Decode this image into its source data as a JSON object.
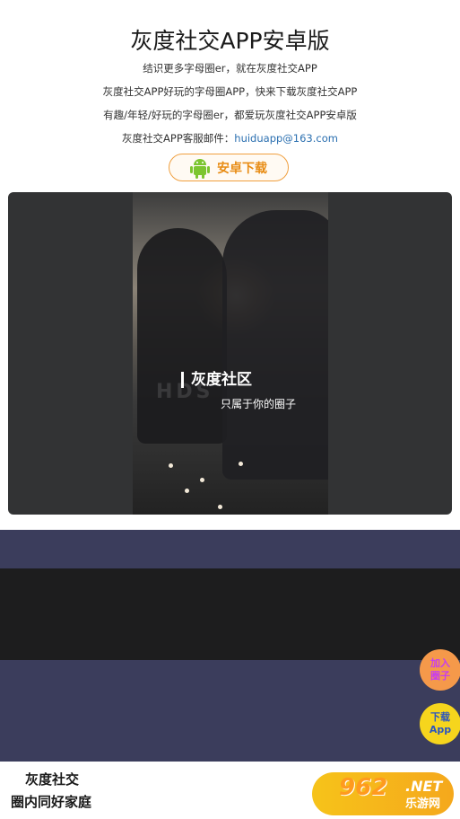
{
  "header": {
    "title": "灰度社交APP安卓版",
    "line1": "结识更多字母圈er，就在灰度社交APP",
    "line2": "灰度社交APP好玩的字母圈APP，快来下载灰度社交APP",
    "line3": "有趣/年轻/好玩的字母圈er，都爱玩灰度社交APP安卓版",
    "email_label": "灰度社交APP客服邮件：",
    "email": "huiduapp@163.com",
    "download_button": "安卓下载"
  },
  "video": {
    "title": "灰度社区",
    "subtitle": "只属于你的圈子",
    "watermark": "HDS"
  },
  "floating": {
    "join_line1": "加入",
    "join_line2": "圈子",
    "download_line1": "下载",
    "download_line2": "App"
  },
  "footer": {
    "line1": "灰度社交",
    "line2": "圈内同好家庭"
  },
  "watermark": {
    "number": "962",
    "net": ".NET",
    "site": "乐游网"
  },
  "colors": {
    "accent_orange": "#e88c14",
    "band": "#3b3d5c",
    "email": "#2a6fb0"
  }
}
